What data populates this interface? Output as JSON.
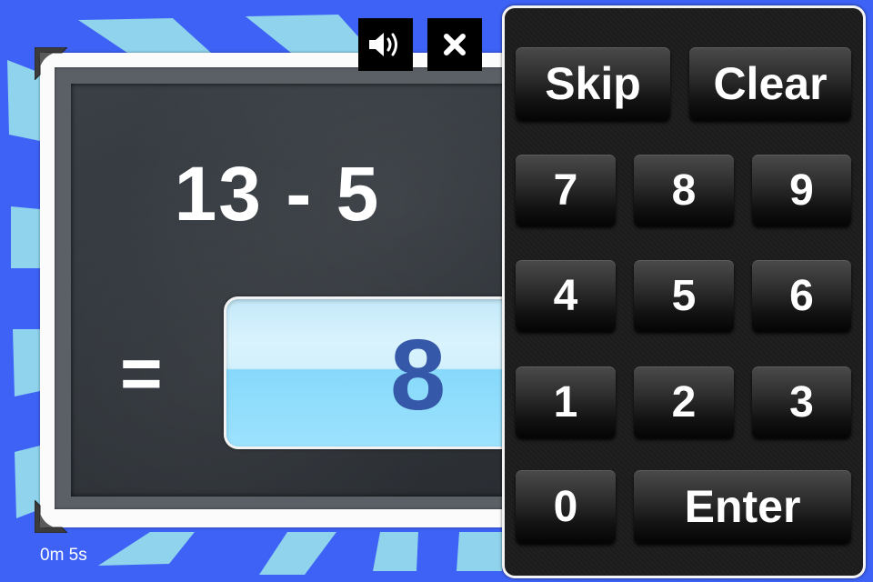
{
  "theme": {
    "background": "#3d62f5",
    "stripe": "#8fd3ec",
    "answer_text": "#3658a8",
    "chalk": "#ffffff"
  },
  "toolbar": {
    "sound_icon": "speaker-icon",
    "close_icon": "close-icon"
  },
  "problem": {
    "expression": "13 - 5",
    "equals": "="
  },
  "answer": {
    "value": "8"
  },
  "timer": {
    "label": "0m 5s"
  },
  "keypad": {
    "skip": "Skip",
    "clear": "Clear",
    "digits": [
      "7",
      "8",
      "9",
      "4",
      "5",
      "6",
      "1",
      "2",
      "3",
      "0"
    ],
    "enter": "Enter"
  }
}
